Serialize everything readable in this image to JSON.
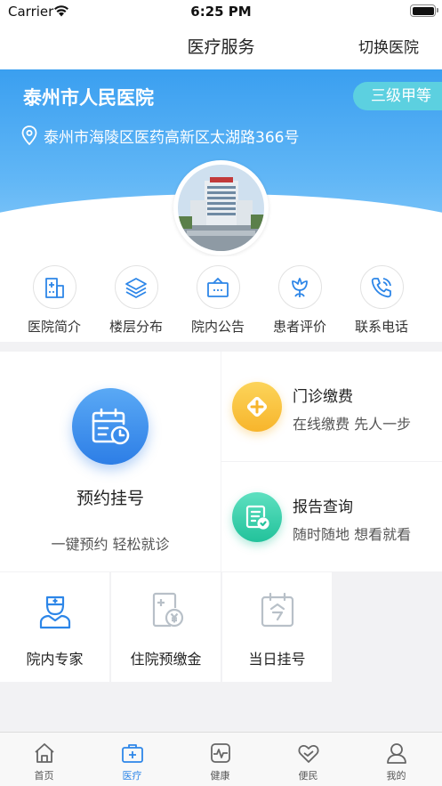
{
  "status_bar": {
    "carrier": "Carrier",
    "time": "6:25 PM"
  },
  "nav": {
    "title": "医疗服务",
    "switch_label": "切换医院"
  },
  "hospital": {
    "name": "泰州市人民医院",
    "grade": "三级甲等",
    "address": "泰州市海陵区医药高新区太湖路366号"
  },
  "quick_links": [
    {
      "label": "医院简介",
      "icon": "hospital-building-icon"
    },
    {
      "label": "楼层分布",
      "icon": "layers-icon"
    },
    {
      "label": "院内公告",
      "icon": "notice-board-icon"
    },
    {
      "label": "患者评价",
      "icon": "flower-icon"
    },
    {
      "label": "联系电话",
      "icon": "phone-icon"
    }
  ],
  "services": {
    "appointment": {
      "title": "预约挂号",
      "subtitle": "一键预约 轻松就诊",
      "icon": "calendar-clock-icon"
    },
    "payment": {
      "title": "门诊缴费",
      "subtitle": "在线缴费 先人一步",
      "icon": "plus-diamond-icon"
    },
    "report": {
      "title": "报告查询",
      "subtitle": "随时随地 想看就看",
      "icon": "report-check-icon"
    },
    "small": [
      {
        "label": "院内专家",
        "icon": "doctor-icon"
      },
      {
        "label": "住院预缴金",
        "icon": "deposit-icon"
      },
      {
        "label": "当日挂号",
        "icon": "today-calendar-icon"
      }
    ]
  },
  "tabs": [
    {
      "label": "首页",
      "icon": "home-icon"
    },
    {
      "label": "医疗",
      "icon": "medical-kit-icon",
      "active": true
    },
    {
      "label": "健康",
      "icon": "heartbeat-icon"
    },
    {
      "label": "便民",
      "icon": "heart-hand-icon"
    },
    {
      "label": "我的",
      "icon": "user-icon"
    }
  ],
  "colors": {
    "accent": "#2d86e8",
    "hero_top": "#3a9ff0",
    "badge": "#5cd0e0",
    "payment": "#f7b52c",
    "report": "#22c29b"
  }
}
